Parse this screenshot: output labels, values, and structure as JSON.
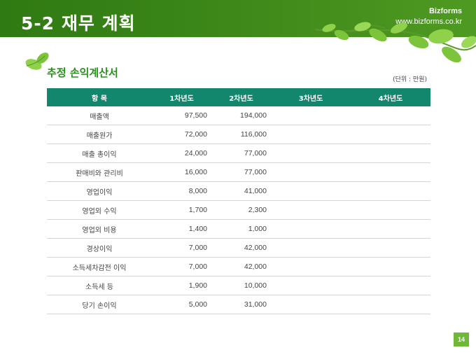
{
  "header": {
    "title": "5-2 재무 계획",
    "brand": "Bizforms",
    "url": "www.bizforms.co.kr"
  },
  "section": {
    "title": "추정 손익계산서",
    "unit": "(단위 : 만원)"
  },
  "table": {
    "headers": [
      "항 목",
      "1차년도",
      "2차년도",
      "3차년도",
      "4차년도"
    ],
    "rows": [
      [
        "매출액",
        "97,500",
        "194,000",
        "",
        ""
      ],
      [
        "매출원가",
        "72,000",
        "116,000",
        "",
        ""
      ],
      [
        "매출 총이익",
        "24,000",
        "77,000",
        "",
        ""
      ],
      [
        "판매비와 관리비",
        "16,000",
        "77,000",
        "",
        ""
      ],
      [
        "영업이익",
        "8,000",
        "41,000",
        "",
        ""
      ],
      [
        "영업외 수익",
        "1,700",
        "2,300",
        "",
        ""
      ],
      [
        "영업외 비용",
        "1,400",
        "1,000",
        "",
        ""
      ],
      [
        "경상이익",
        "7,000",
        "42,000",
        "",
        ""
      ],
      [
        "소득세차감전 이익",
        "7,000",
        "42,000",
        "",
        ""
      ],
      [
        "소득세 등",
        "1,900",
        "10,000",
        "",
        ""
      ],
      [
        "당기 손이익",
        "5,000",
        "31,000",
        "",
        ""
      ]
    ]
  },
  "footer": {
    "page": "14"
  },
  "colors": {
    "header_green": "#3f8a1a",
    "table_header": "#13866e",
    "section_title": "#2a8f1e",
    "leaf": "#7cc53a"
  },
  "icons": [
    "leaf-vine-icon",
    "leaf-icon"
  ]
}
